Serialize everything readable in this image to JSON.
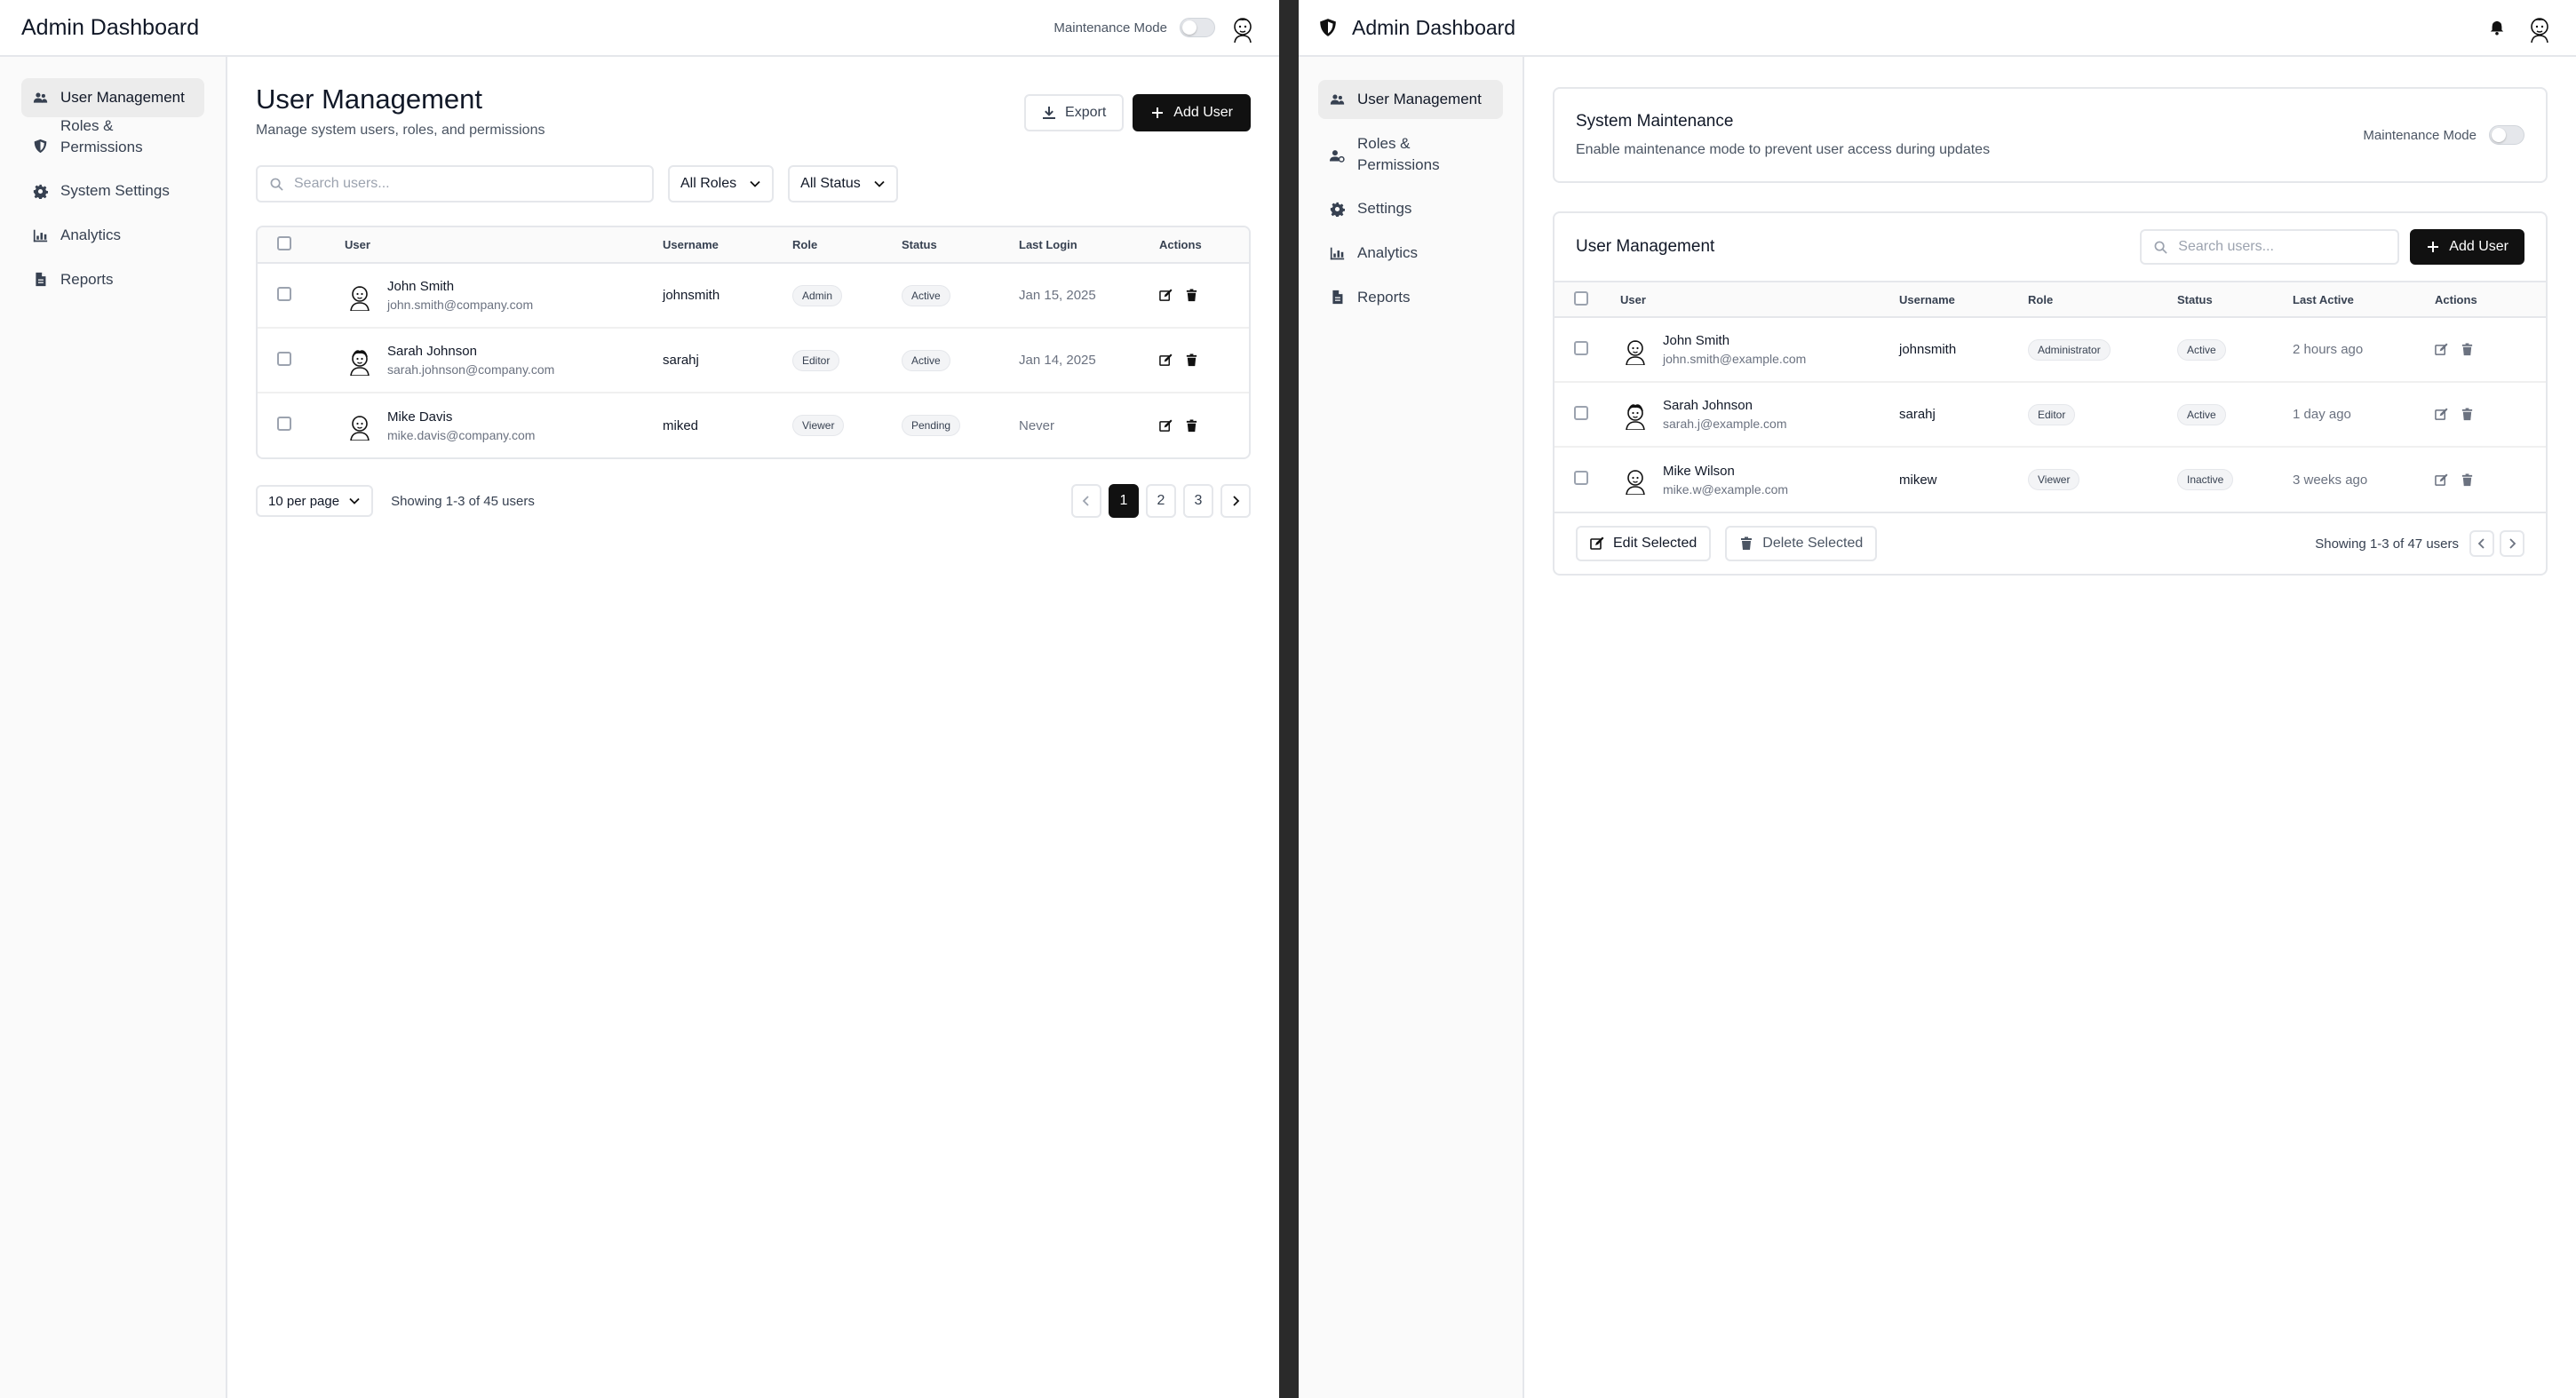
{
  "left": {
    "header": {
      "title": "Admin Dashboard",
      "maintenance_label": "Maintenance Mode"
    },
    "sidebar": [
      {
        "label": "User Management",
        "icon": "users-icon"
      },
      {
        "label": "Roles & Permissions",
        "icon": "shield-icon"
      },
      {
        "label": "System Settings",
        "icon": "gear-icon"
      },
      {
        "label": "Analytics",
        "icon": "chart-icon"
      },
      {
        "label": "Reports",
        "icon": "file-icon"
      }
    ],
    "page": {
      "title": "User Management",
      "subtitle": "Manage system users, roles, and permissions"
    },
    "toolbar": {
      "export_label": "Export",
      "add_label": "Add User"
    },
    "filters": {
      "search_placeholder": "Search users...",
      "role_value": "All Roles",
      "status_value": "All Status"
    },
    "table": {
      "headers": [
        "User",
        "Username",
        "Role",
        "Status",
        "Last Login",
        "Actions"
      ],
      "rows": [
        {
          "name": "John Smith",
          "email": "john.smith@company.com",
          "username": "johnsmith",
          "role": "Admin",
          "status": "Active",
          "last": "Jan 15, 2025"
        },
        {
          "name": "Sarah Johnson",
          "email": "sarah.johnson@company.com",
          "username": "sarahj",
          "role": "Editor",
          "status": "Active",
          "last": "Jan 14, 2025"
        },
        {
          "name": "Mike Davis",
          "email": "mike.davis@company.com",
          "username": "miked",
          "role": "Viewer",
          "status": "Pending",
          "last": "Never"
        }
      ]
    },
    "footer": {
      "per_page": "10 per page",
      "showing": "Showing 1-3 of 45 users",
      "pages": [
        "1",
        "2",
        "3"
      ]
    }
  },
  "right": {
    "header": {
      "title": "Admin Dashboard"
    },
    "sidebar": [
      {
        "label": "User Management",
        "icon": "users-icon"
      },
      {
        "label": "Roles & Permissions",
        "icon": "user-gear-icon"
      },
      {
        "label": "Settings",
        "icon": "gear-icon"
      },
      {
        "label": "Analytics",
        "icon": "chart-icon"
      },
      {
        "label": "Reports",
        "icon": "file-icon"
      }
    ],
    "maintenance": {
      "title": "System Maintenance",
      "description": "Enable maintenance mode to prevent user access during updates",
      "toggle_label": "Maintenance Mode"
    },
    "users": {
      "title": "User Management",
      "search_placeholder": "Search users...",
      "add_label": "Add User",
      "headers": [
        "User",
        "Username",
        "Role",
        "Status",
        "Last Active",
        "Actions"
      ],
      "rows": [
        {
          "name": "John Smith",
          "email": "john.smith@example.com",
          "username": "johnsmith",
          "role": "Administrator",
          "status": "Active",
          "last": "2 hours ago"
        },
        {
          "name": "Sarah Johnson",
          "email": "sarah.j@example.com",
          "username": "sarahj",
          "role": "Editor",
          "status": "Active",
          "last": "1 day ago"
        },
        {
          "name": "Mike Wilson",
          "email": "mike.w@example.com",
          "username": "mikew",
          "role": "Viewer",
          "status": "Inactive",
          "last": "3 weeks ago"
        }
      ],
      "edit_selected": "Edit Selected",
      "delete_selected": "Delete Selected",
      "showing": "Showing 1-3 of 47 users"
    }
  }
}
